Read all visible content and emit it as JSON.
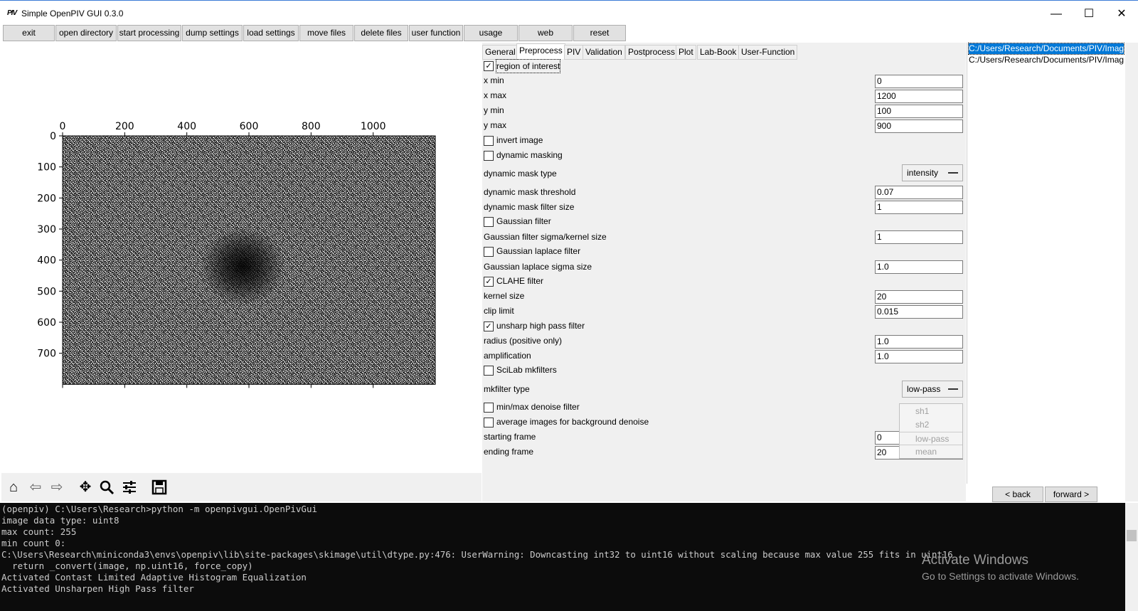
{
  "window": {
    "icon_text": "PIV",
    "title": "Simple OpenPIV GUI 0.3.0",
    "minimize": "—",
    "maximize": "☐",
    "close": "✕"
  },
  "toolbar": {
    "buttons": [
      "exit",
      "open directory",
      "start processing",
      "dump settings",
      "load settings",
      "move files",
      "delete files",
      "user function",
      "usage",
      "web",
      "reset"
    ]
  },
  "plot": {
    "x_ticks": [
      "0",
      "200",
      "400",
      "600",
      "800",
      "1000"
    ],
    "x_tick_values": [
      0,
      200,
      400,
      600,
      800,
      1000
    ],
    "y_ticks": [
      "0",
      "100",
      "200",
      "300",
      "400",
      "500",
      "600",
      "700"
    ],
    "y_tick_values": [
      0,
      100,
      200,
      300,
      400,
      500,
      600,
      700
    ],
    "image_width": 1200,
    "image_height": 800,
    "dark_spot_center": [
      580,
      420
    ]
  },
  "plot_toolbar": {
    "icons": [
      "home-icon",
      "back-arrow-icon",
      "forward-arrow-icon",
      "pan-icon",
      "zoom-icon",
      "configure-icon",
      "save-icon"
    ]
  },
  "tabs": [
    "General",
    "Preprocess",
    "PIV",
    "Validation",
    "Postprocess",
    "Plot",
    "Lab-Book",
    "User-Function"
  ],
  "active_tab": "Preprocess",
  "preprocess": {
    "roi_label": "region of interest",
    "roi_checked": true,
    "x_min_label": "x min",
    "x_min": "0",
    "x_max_label": "x max",
    "x_max": "1200",
    "y_min_label": "y min",
    "y_min": "100",
    "y_max_label": "y max",
    "y_max": "900",
    "invert_label": "invert image",
    "dyn_mask_label": "dynamic masking",
    "dyn_mask_type_label": "dynamic mask type",
    "dyn_mask_type": "intensity",
    "dyn_mask_threshold_label": "dynamic mask threshold",
    "dyn_mask_threshold": "0.07",
    "dyn_mask_filter_label": "dynamic mask filter size",
    "dyn_mask_filter": "1",
    "gauss_label": "Gaussian filter",
    "gauss_sigma_label": "Gaussian filter sigma/kernel size",
    "gauss_sigma": "1",
    "laplace_label": "Gaussian laplace filter",
    "laplace_sigma_label": "Gaussian laplace sigma size",
    "laplace_sigma": "1.0",
    "clahe_label": "CLAHE filter",
    "clahe_checked": true,
    "kernel_label": "kernel size",
    "kernel": "20",
    "clip_label": "clip limit",
    "clip": "0.015",
    "unsharp_label": "unsharp high pass filter",
    "unsharp_checked": true,
    "radius_label": "radius (positive only)",
    "radius": "1.0",
    "amp_label": "amplification",
    "amp": "1.0",
    "scilab_label": "SciLab mkfilters",
    "mkfilter_label": "mkfilter type",
    "mkfilter": "low-pass",
    "mkfilter_options": [
      "sh1",
      "sh2",
      "low-pass",
      "mean"
    ],
    "minmax_label": "min/max denoise filter",
    "avg_label": "average images for background denoise",
    "start_label": "starting frame",
    "start": "0",
    "end_label": "ending frame",
    "end": "20"
  },
  "files": [
    "C:/Users/Research/Documents/PIV/Imag",
    "C:/Users/Research/Documents/PIV/Imag"
  ],
  "nav": {
    "back": "< back",
    "forward": "forward >"
  },
  "console": [
    "(openpiv) C:\\Users\\Research>python -m openpivgui.OpenPivGui",
    "image data type: uint8",
    "max count: 255",
    "min count 0:",
    "C:\\Users\\Research\\miniconda3\\envs\\openpiv\\lib\\site-packages\\skimage\\util\\dtype.py:476: UserWarning: Downcasting int32 to uint16 without scaling because max value 255 fits in uint16",
    "  return _convert(image, np.uint16, force_copy)",
    "Activated Contast Limited Adaptive Histogram Equalization",
    "Activated Unsharpen High Pass filter"
  ],
  "watermark": {
    "title": "Activate Windows",
    "subtitle": "Go to Settings to activate Windows."
  }
}
